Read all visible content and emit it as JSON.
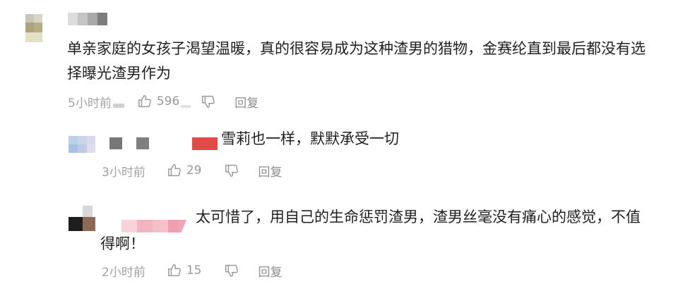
{
  "comments": [
    {
      "text_line1": "单亲家庭的女孩子渴望温暖，真的很容易成为这种渣男的猎物，金赛纶直到最后都没有选",
      "text_line2": "择曝光渣男作为",
      "time": "5小时前",
      "likes": "596",
      "reply_label": "回复"
    },
    {
      "text_line1": "雪莉也一样，默默承受一切",
      "time": "3小时前",
      "likes": "29",
      "reply_label": "回复"
    },
    {
      "text_line1": "太可惜了，用自己的生命惩罚渣男，渣男丝毫没有痛心的感觉，不值",
      "text_line2": "得啊！",
      "time": "2小时前",
      "likes": "15",
      "reply_label": "回复"
    }
  ],
  "icons": {
    "like": "thumbs-up-icon",
    "dislike": "thumbs-down-icon"
  },
  "colors": {
    "text": "#1f1f1f",
    "meta": "#9a9a9a",
    "redacted_red": "#e04848",
    "redacted_pink": "#f4a9b6"
  }
}
